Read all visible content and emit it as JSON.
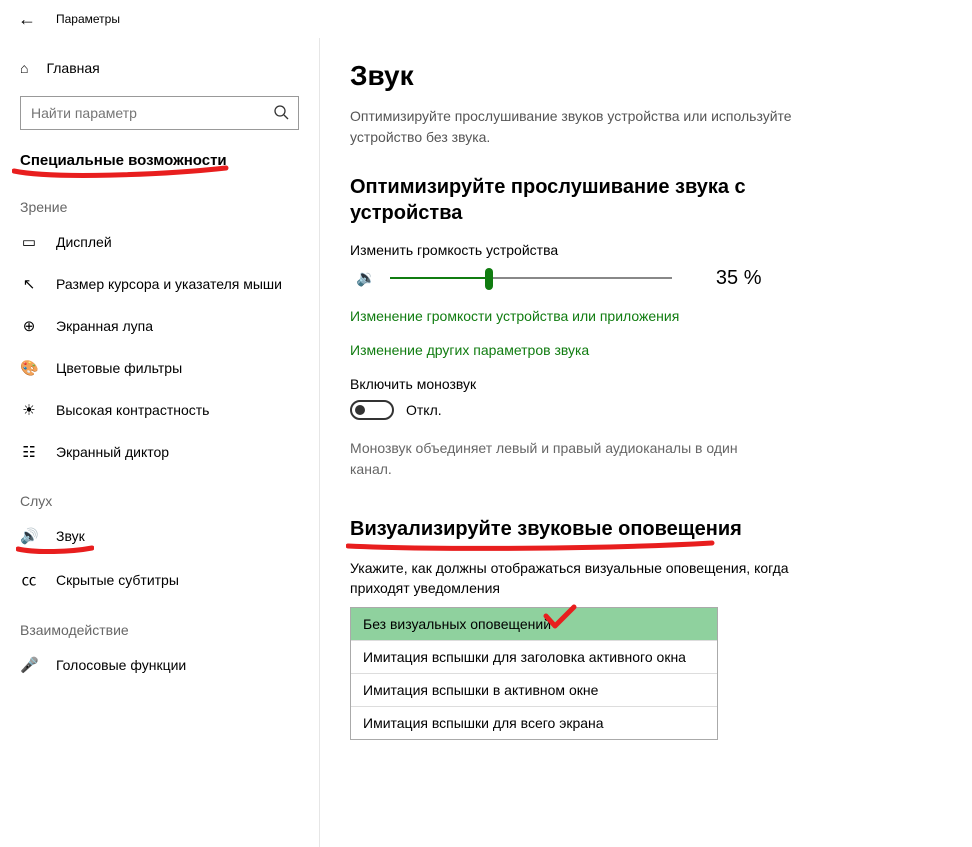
{
  "topBar": {
    "title": "Параметры"
  },
  "sidebar": {
    "home": "Главная",
    "searchPlaceholder": "Найти параметр",
    "sectionTitle": "Специальные возможности",
    "groups": {
      "vision": {
        "label": "Зрение",
        "items": [
          {
            "key": "display",
            "label": "Дисплей"
          },
          {
            "key": "cursor",
            "label": "Размер курсора и указателя мыши"
          },
          {
            "key": "magnifier",
            "label": "Экранная лупа"
          },
          {
            "key": "colorfilters",
            "label": "Цветовые фильтры"
          },
          {
            "key": "contrast",
            "label": "Высокая контрастность"
          },
          {
            "key": "narrator",
            "label": "Экранный диктор"
          }
        ]
      },
      "hearing": {
        "label": "Слух",
        "items": [
          {
            "key": "sound",
            "label": "Звук"
          },
          {
            "key": "captions",
            "label": "Скрытые субтитры"
          }
        ]
      },
      "interaction": {
        "label": "Взаимодействие",
        "items": [
          {
            "key": "speech",
            "label": "Голосовые функции"
          }
        ]
      }
    }
  },
  "page": {
    "title": "Звук",
    "desc": "Оптимизируйте прослушивание звуков устройства или используйте устройство без звука.",
    "optimize": {
      "heading": "Оптимизируйте прослушивание звука с устройства",
      "volumeLabel": "Изменить громкость устройства",
      "volumePercent": 35,
      "volumeDisplay": "35 %",
      "link1": "Изменение громкости устройства или приложения",
      "link2": "Изменение других параметров звука",
      "monoLabel": "Включить монозвук",
      "monoState": "Откл.",
      "monoHint": "Монозвук объединяет левый и правый аудиоканалы в один канал."
    },
    "visual": {
      "heading": "Визуализируйте звуковые оповещения",
      "desc": "Укажите, как должны отображаться визуальные оповещения, когда приходят уведомления",
      "options": [
        "Без визуальных оповещений",
        "Имитация вспышки для заголовка активного окна",
        "Имитация вспышки в активном окне",
        "Имитация вспышки для всего экрана"
      ],
      "selectedIndex": 0
    }
  }
}
